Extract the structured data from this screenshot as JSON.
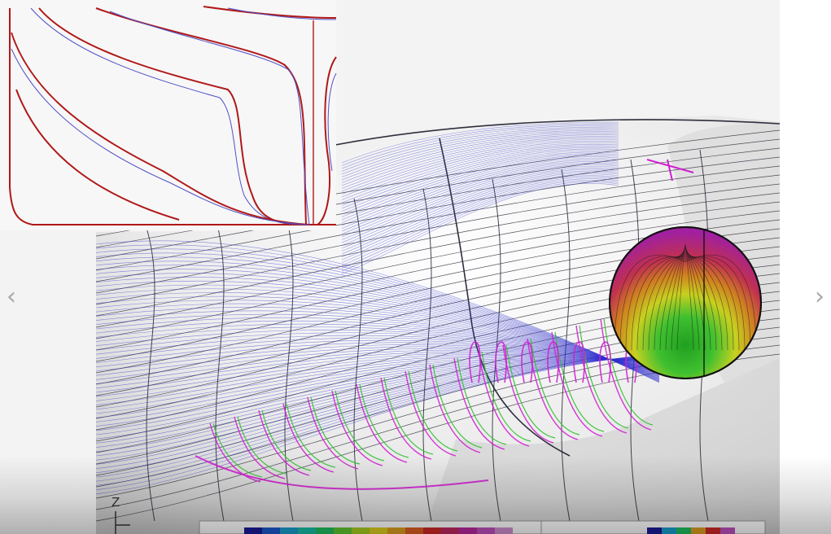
{
  "viewer": {
    "prev_glyph": "‹",
    "next_glyph": "›",
    "prev_icon": "chevron-left-icon",
    "next_icon": "chevron-right-icon"
  },
  "figure": {
    "axis_label": "Z",
    "colors": {
      "section_design": "#b01818",
      "section_alt": "#5050c8",
      "streamline": "#3030d0",
      "mesh": "#1a1a2a",
      "wake_magenta": "#d020d0",
      "wake_green": "#30c030"
    },
    "legend_left_colors": [
      "#1a1a9a",
      "#1a5ad0",
      "#18a0d0",
      "#18c0a8",
      "#20c060",
      "#60c830",
      "#a8d020",
      "#e0d020",
      "#e0a020",
      "#e06020",
      "#d02828",
      "#c02860",
      "#b828a0",
      "#c050c0",
      "#d090d0"
    ],
    "legend_right_colors": [
      "#1a1a9a",
      "#18a0d0",
      "#20c060",
      "#e0a020",
      "#d02828",
      "#c050c0"
    ]
  }
}
